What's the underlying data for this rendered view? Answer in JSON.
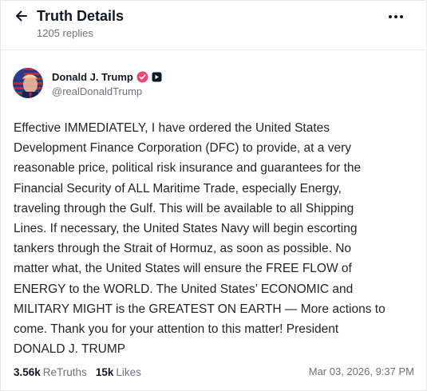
{
  "header": {
    "title": "Truth Details",
    "replies": "1205 replies"
  },
  "icons": {
    "back": "arrow-left-icon",
    "more": "more-horizontal-icon",
    "verified": "verified-badge-icon",
    "media": "media-badge-icon"
  },
  "author": {
    "name": "Donald J. Trump",
    "handle": "@realDonaldTrump"
  },
  "post": {
    "lines": [
      "Effective IMMEDIATELY, I have ordered the United States",
      "Development Finance Corporation (DFC) to provide, at a very",
      "reasonable price, political risk insurance and guarantees for the",
      "Financial Security of ALL Maritime Trade, especially Energy,",
      "traveling through the Gulf. This will be available to all Shipping",
      "Lines. If necessary, the United States Navy will begin escorting",
      "tankers through the Strait of Hormuz, as soon as possible. No",
      "matter what, the United States will ensure the FREE FLOW of",
      "ENERGY to the WORLD. The United States’ ECONOMIC and",
      "MILITARY MIGHT is the GREATEST ON EARTH — More actions to",
      "come. Thank you for your attention to this matter! President",
      "DONALD J. TRUMP"
    ]
  },
  "stats": {
    "retruths_count": "3.56k",
    "retruths_label": "ReTruths",
    "likes_count": "15k",
    "likes_label": "Likes"
  },
  "timestamp": "Mar 03, 2026, 9:37 PM",
  "colors": {
    "text": "#1f2328",
    "muted": "#6b7280",
    "verified": "#ec4872",
    "divider": "#ececef"
  }
}
